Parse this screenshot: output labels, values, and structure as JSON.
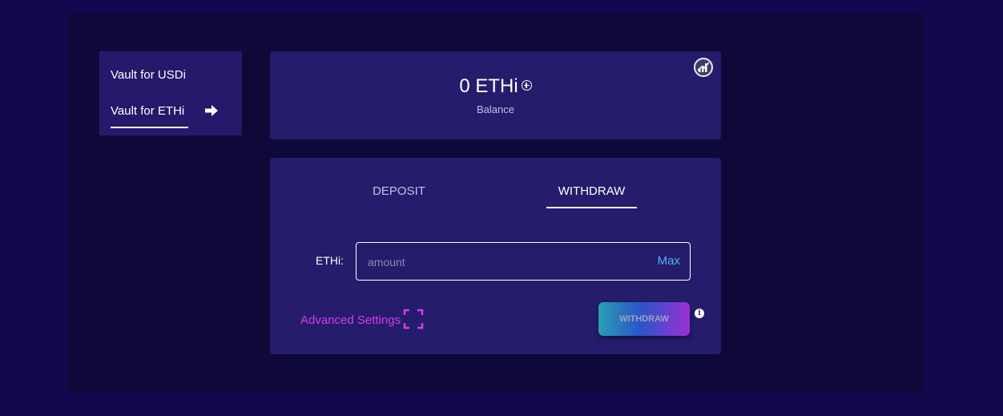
{
  "sidebar": {
    "items": [
      {
        "label": "Vault for USDi"
      },
      {
        "label": "Vault for ETHi"
      }
    ],
    "active_icon": "arrow-right-icon"
  },
  "balance": {
    "value": "0 ETHi",
    "label": "Balance",
    "add_icon": "plus-circle-icon",
    "chart_icon": "bar-chart-icon"
  },
  "tabs": [
    {
      "label": "DEPOSIT",
      "active": false
    },
    {
      "label": "WITHDRAW",
      "active": true
    }
  ],
  "form": {
    "field_label": "ETHi:",
    "placeholder": "amount",
    "value": "",
    "max_label": "Max",
    "advanced_label": "Advanced Settings",
    "expand_icon": "expand-icon",
    "submit_label": "WITHDRAW",
    "info_icon": "info-icon"
  },
  "colors": {
    "page_bg": "#14074f",
    "frame_bg": "#0e0939",
    "card_bg": "#251c6c",
    "accent_magenta": "#d63be8",
    "accent_blue": "#4fb1f2"
  }
}
